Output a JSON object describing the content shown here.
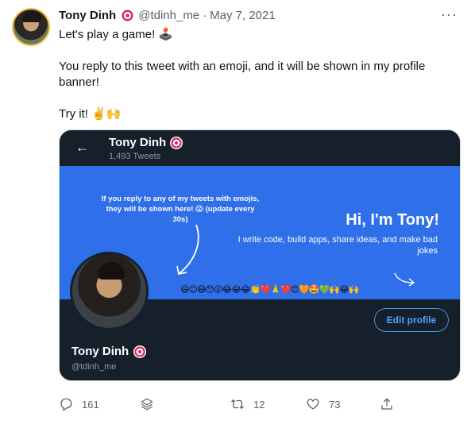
{
  "tweet": {
    "author_name": "Tony Dinh",
    "handle": "@tdinh_me",
    "separator": "·",
    "date": "May 7, 2021",
    "more": "···",
    "lines": [
      "Let's play a game! 🕹️",
      "You reply to this tweet with an emoji, and it will be shown in my profile banner!",
      "Try it! ✌️🙌"
    ]
  },
  "media": {
    "back": "←",
    "profile_name": "Tony Dinh",
    "tweet_count": "1,493 Tweets",
    "banner": {
      "left_text": "If you reply to any of my tweets with emojis, they will be shown here! 😱 (update every 30s)",
      "headline": "Hi, I'm Tony!",
      "tagline": "I write code, build apps, share ideas, and make bad jokes",
      "emojis": "😆😊😷😯😲😂😂😂👏❤️🙏❤️😍🧡🤩💚🙌😂🙌"
    },
    "edit_profile": "Edit profile",
    "display_name": "Tony Dinh",
    "display_handle": "@tdinh_me"
  },
  "actions": {
    "replies": "161",
    "retweets": "12",
    "likes": "73"
  },
  "icons": [
    "target-icon",
    "reply-icon",
    "stack-icon",
    "retweet-icon",
    "heart-icon",
    "share-icon"
  ],
  "colors": {
    "banner": "#2f6fea",
    "dark": "#15202b",
    "muted": "#536471",
    "accent": "#4aa3ff"
  }
}
